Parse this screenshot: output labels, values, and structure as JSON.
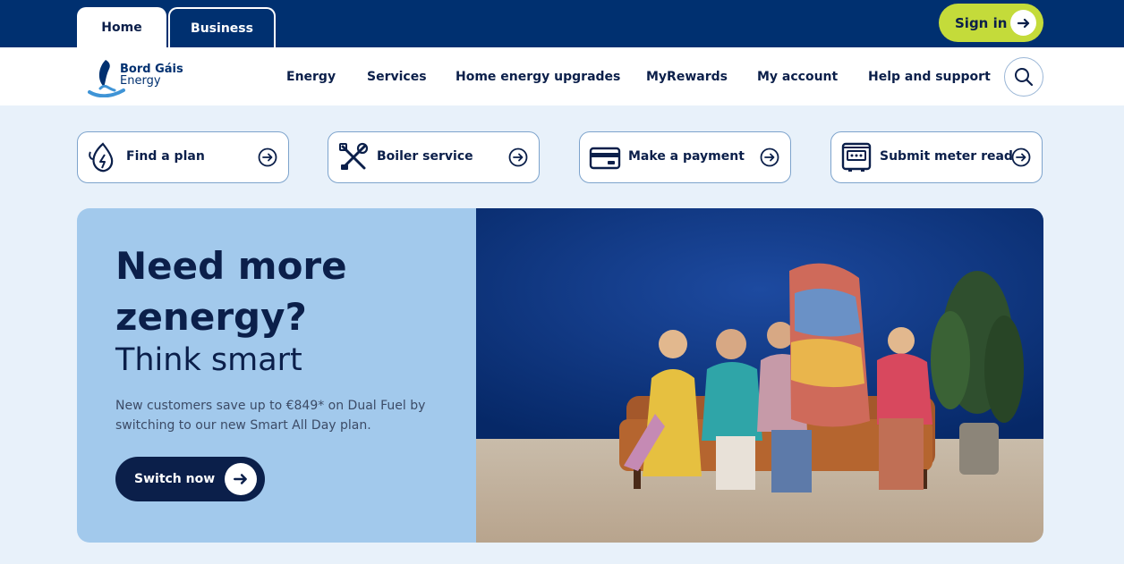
{
  "topbar": {
    "tabs": [
      {
        "label": "Home",
        "active": true
      },
      {
        "label": "Business",
        "active": false
      }
    ],
    "signin_label": "Sign in"
  },
  "brand": {
    "line1": "Bord Gáis",
    "line2": "Energy"
  },
  "nav": {
    "items": [
      "Energy",
      "Services",
      "Home energy upgrades",
      "MyRewards",
      "My account",
      "Help and support"
    ],
    "search_icon": "search-icon"
  },
  "quick_links": [
    {
      "label": "Find a plan",
      "icon": "gas-electric-icon"
    },
    {
      "label": "Boiler service",
      "icon": "tools-icon"
    },
    {
      "label": "Make a payment",
      "icon": "credit-card-icon"
    },
    {
      "label": "Submit meter read",
      "icon": "meter-icon"
    }
  ],
  "hero": {
    "heading": "Need more zenergy?",
    "subheading": "Think smart",
    "body": "New customers save up to €849* on Dual Fuel by switching to our new Smart All Day plan.",
    "cta_label": "Switch now"
  },
  "colors": {
    "navy": "#003070",
    "dark_navy": "#0b1f4a",
    "lime": "#c4db3a",
    "hero_blue": "#a2c9ec",
    "page_bg": "#e8f1fa"
  }
}
